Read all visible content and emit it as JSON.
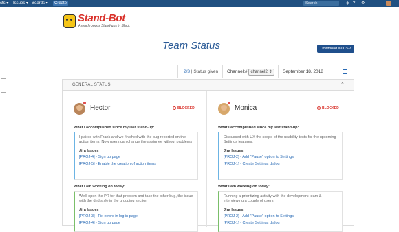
{
  "topbar": {
    "nav_items": [
      "cts ▾",
      "Issues ▾",
      "Boards ▾"
    ],
    "create_label": "Create",
    "search_placeholder": "Search",
    "icons": [
      "bell-icon",
      "help-icon",
      "gear-icon"
    ]
  },
  "logo": {
    "title": "Stand-Bot",
    "tagline": "Asynchronous Stand-ups in Slack"
  },
  "page_title": "Team Status",
  "download_label": "Download as CSV",
  "filters": {
    "given_fraction": "2/3",
    "given_label": "Status given",
    "channel_label": "Channel:#",
    "channel_value": "channel2 ⇕",
    "date": "September 18, 2018"
  },
  "general": {
    "heading": "GENERAL STATUS",
    "collapse_symbol": "⌃"
  },
  "people": [
    {
      "name": "Hector",
      "status": "BLOCKED",
      "accomplished_label": "What I accomplished since my last stand-up:",
      "accomplished_text": "I paired with Frank and we finished with the bug reported on the action items. Now users can change the assignee without problems",
      "accomplished_issues_label": "Jira Issues",
      "accomplished_issues": [
        "[PROJ-4] - Sign up page",
        "[PROJ-5] - Enable the creation of action items"
      ],
      "working_label": "What I am working on today:",
      "working_text": "We'll open the PR for that problem and take the other bug, the issue with the dnd style in the grouping section",
      "working_issues_label": "Jira Issues",
      "working_issues": [
        "[PROJ-3] - Fix errors in log in page",
        "[PROJ-4] - Sign up page"
      ]
    },
    {
      "name": "Monica",
      "status": "BLOCKED",
      "accomplished_label": "What I accomplished since my last stand-up:",
      "accomplished_text": "Discussed with UX the scope of the usability tests for the upcoming Settings features.",
      "accomplished_issues_label": "Jira Issues",
      "accomplished_issues": [
        "[PROJ-2] - Add \"Pause\" option to Settings",
        "[PROJ-1] - Create Settings dialog"
      ],
      "working_label": "What I am working on today:",
      "working_text": "Running a prioritizing activity with the development team & interviewing a couple of users.",
      "working_issues_label": "Jira Issues",
      "working_issues": [
        "[PROJ-2] - Add \"Pause\" option to Settings",
        "[PROJ-1] - Create Settings dialog"
      ]
    }
  ]
}
